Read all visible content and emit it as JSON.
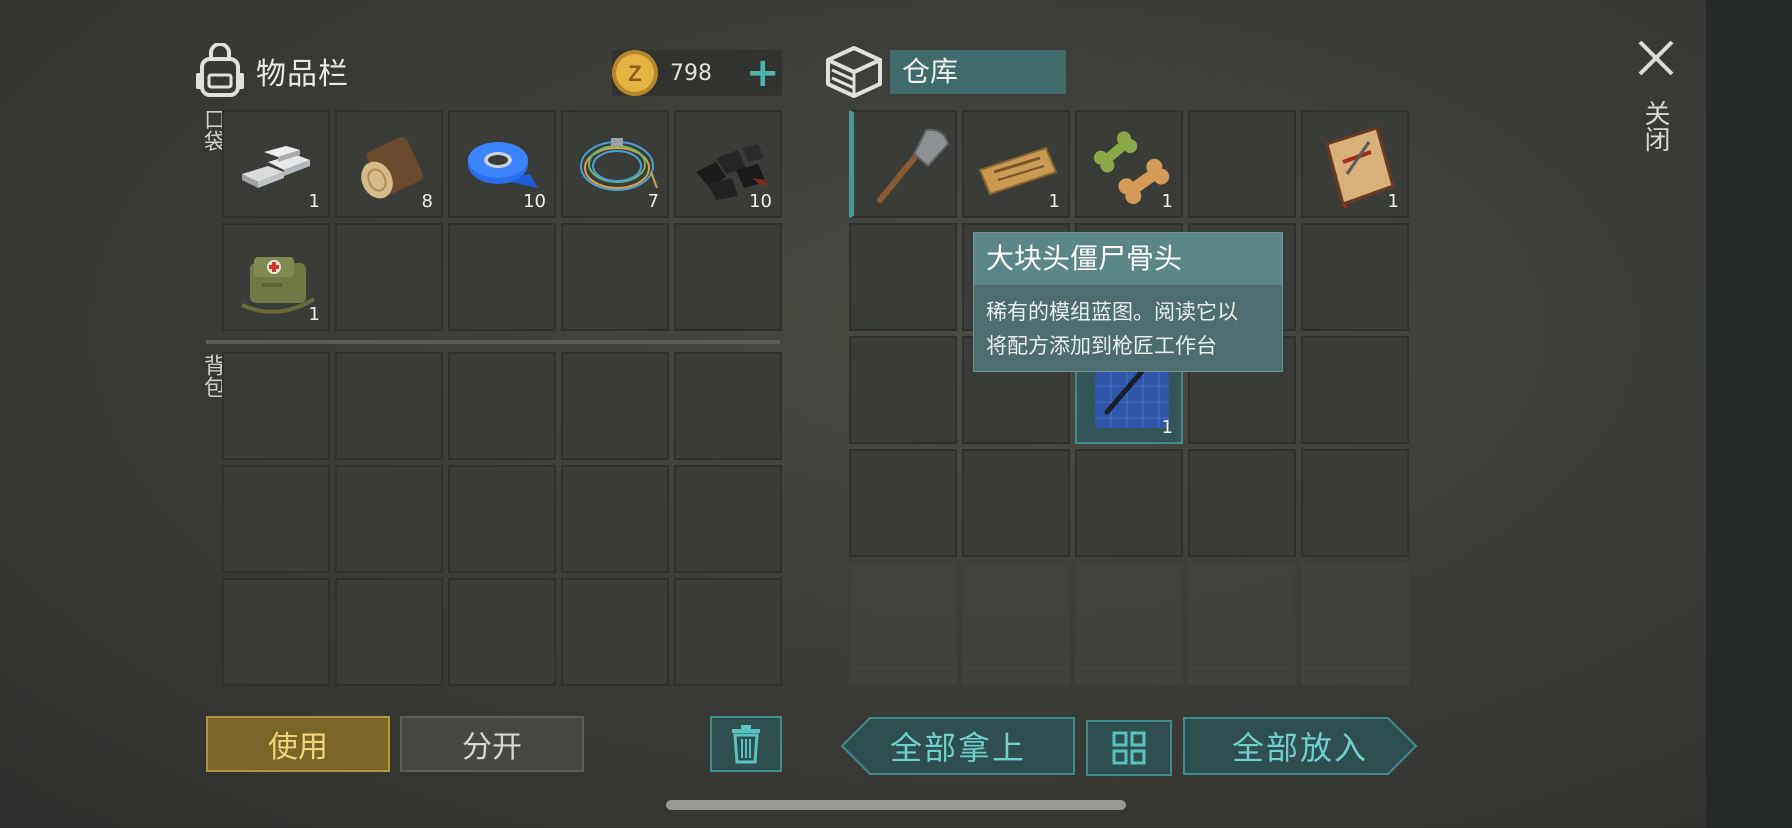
{
  "inventory": {
    "title": "物品栏",
    "coins": "798",
    "add_label": "+",
    "pockets_label": "口袋",
    "backpack_label": "背包",
    "pockets": [
      {
        "icon": "metal-bars-icon",
        "count": "1"
      },
      {
        "icon": "log-icon",
        "count": "8"
      },
      {
        "icon": "blue-tape-icon",
        "count": "10"
      },
      {
        "icon": "wire-coil-icon",
        "count": "7"
      },
      {
        "icon": "coal-icon",
        "count": "10"
      },
      {
        "icon": "medkit-bag-icon",
        "count": "1"
      },
      {
        "icon": "",
        "count": ""
      },
      {
        "icon": "",
        "count": ""
      },
      {
        "icon": "",
        "count": ""
      },
      {
        "icon": "",
        "count": ""
      }
    ]
  },
  "storage": {
    "title": "仓库",
    "items": [
      {
        "icon": "shovel-icon",
        "count": ""
      },
      {
        "icon": "coupon-icon",
        "count": "1"
      },
      {
        "icon": "bones-icon",
        "count": "1"
      },
      {
        "icon": "",
        "count": ""
      },
      {
        "icon": "diary-icon",
        "count": "1"
      },
      {
        "icon": "blueprint-icon",
        "count": "1"
      }
    ]
  },
  "tooltip": {
    "title": "大块头僵尸骨头",
    "desc_line1": "稀有的模组蓝图。阅读它以",
    "desc_line2": "将配方添加到枪匠工作台"
  },
  "close": {
    "label": "关闭"
  },
  "buttons": {
    "use": "使用",
    "split": "分开",
    "take_all": "全部拿上",
    "put_all": "全部放入"
  },
  "colors": {
    "accent": "#3f8b8d",
    "use_button": "#7b6428",
    "coin": "#d8a93a"
  }
}
